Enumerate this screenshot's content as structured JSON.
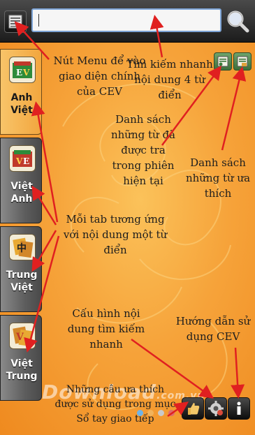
{
  "search": {
    "value": "",
    "placeholder": ""
  },
  "tabs": [
    {
      "label_line1": "Anh",
      "label_line2": "Việt",
      "icon": "dictionary-en-vi-icon",
      "active": true
    },
    {
      "label_line1": "Việt",
      "label_line2": "Anh",
      "icon": "dictionary-vi-en-icon",
      "active": false
    },
    {
      "label_line1": "Trung",
      "label_line2": "Việt",
      "icon": "dictionary-zh-vi-icon",
      "active": false
    },
    {
      "label_line1": "Việt",
      "label_line2": "Trung",
      "icon": "dictionary-vi-zh-icon",
      "active": false
    }
  ],
  "annotations": {
    "menu_button": [
      "Nút Menu để vào",
      "giao diện chính",
      "của CEV"
    ],
    "quick_search": [
      "Tìm kiếm nhanh",
      "nội dung 4 từ",
      "điển"
    ],
    "history_list": [
      "Danh sách",
      "những từ đã",
      "được tra",
      "trong phiên",
      "hiện tại"
    ],
    "favorites_list": [
      "Danh sách",
      "những từ ưa",
      "thích"
    ],
    "tabs_note": [
      "Mỗi tab tương ứng",
      "với nội dung một từ",
      "điển"
    ],
    "search_config": [
      "Cấu hình nội",
      "dung tìm kiếm",
      "nhanh"
    ],
    "help": [
      "Hướng dẫn sử",
      "dụng CEV"
    ],
    "phrasebook": [
      "Những câu ưa thích",
      "được sử dụng trong mục",
      "Sổ tay giao tiếp"
    ]
  },
  "watermark": {
    "main": "Download",
    "suffix": ".com.vn"
  },
  "colors": {
    "accent_orange": "#f6a33a",
    "active_tab": "#f2a63e",
    "arrow_red": "#e02020",
    "search_border": "#7da4d6"
  },
  "icons": {
    "menu": "menu-list-icon",
    "search": "magnifier-icon",
    "history": "history-list-icon",
    "favorites": "favorites-list-icon",
    "phrasebook": "thumbs-up-icon",
    "settings": "gear-icon",
    "help": "info-icon"
  }
}
